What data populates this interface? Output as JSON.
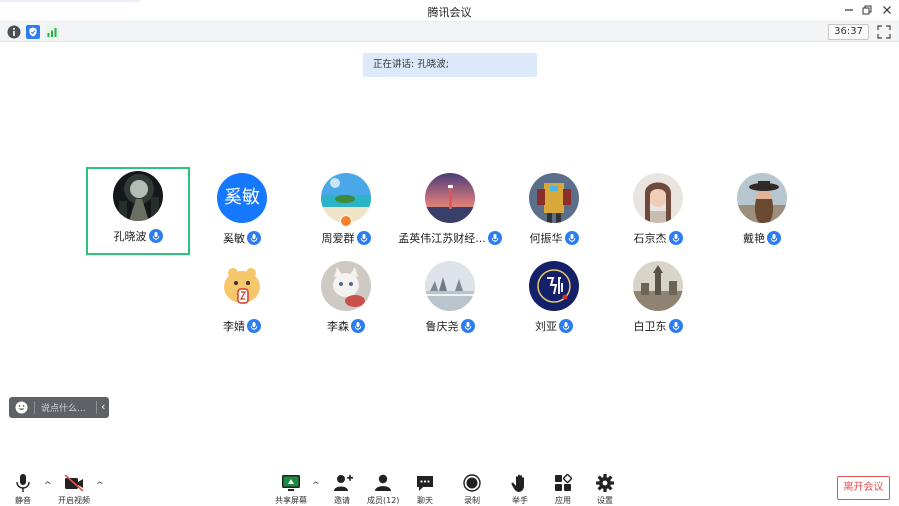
{
  "window": {
    "title": "腾讯会议"
  },
  "status": {
    "timer": "36:37"
  },
  "speaking": {
    "text": "正在讲话: 孔晓波;"
  },
  "participants": [
    {
      "name": "孔晓波",
      "avatar": "night-path-photo",
      "active": true
    },
    {
      "name": "奚敏",
      "avatar_text": "奚敏"
    },
    {
      "name": "周爱群",
      "avatar": "beach-photo",
      "host": true
    },
    {
      "name": "孟英伟江苏财经...",
      "avatar": "lighthouse-sunset-photo"
    },
    {
      "name": "何振华",
      "avatar": "robot-figure-photo"
    },
    {
      "name": "石京杰",
      "avatar": "woman-portrait-photo"
    },
    {
      "name": "戴艳",
      "avatar": "hat-portrait-photo"
    },
    {
      "name": "李婧",
      "avatar": "cartoon-animal"
    },
    {
      "name": "李森",
      "avatar": "cat-photo"
    },
    {
      "name": "鲁庆尧",
      "avatar": "lake-mist-photo"
    },
    {
      "name": "刘亚",
      "avatar": "calligraphy-seal"
    },
    {
      "name": "白卫东",
      "avatar": "city-landmark-photo"
    }
  ],
  "chat": {
    "placeholder": "说点什么..."
  },
  "toolbar": {
    "mute": "静音",
    "video": "开启视频",
    "share": "共享屏幕",
    "invite": "邀请",
    "members": "成员(12)",
    "chat": "聊天",
    "record": "录制",
    "raise_hand": "举手",
    "apps": "应用",
    "settings": "设置",
    "leave": "离开会议"
  },
  "colors": {
    "accent": "#2c7ef0",
    "active_border": "#2bc37a",
    "leave": "#e2524f",
    "banner": "#dbe9fb"
  }
}
